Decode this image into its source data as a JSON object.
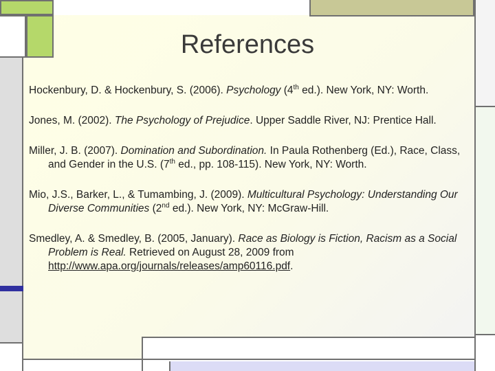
{
  "slide": {
    "title": "References"
  },
  "references": [
    {
      "authors": "Hockenbury, D. & Hockenbury, S. (2006).  ",
      "title": "Psychology",
      "t1": " (4",
      "sup": "th",
      "t2": " ed.).  New York, NY: Worth."
    },
    {
      "authors": "Jones, M. (2002).  ",
      "title": "The Psychology of Prejudice",
      "rest": ".  Upper Saddle River, NJ: Prentice Hall."
    },
    {
      "authors": "Miller, J. B. (2007).  ",
      "title": "Domination and Subordination.",
      "t1": "  In Paula Rothenberg (Ed.), Race, Class, and Gender in the U.S. (7",
      "sup": "th",
      "t2": " ed., pp. 108-115).  New York, NY: Worth."
    },
    {
      "authors": "Mio, J.S., Barker, L., & Tumambing, J.  (2009).  ",
      "title": "Multicultural Psychology: Understanding Our Diverse Communities",
      "t1": " (2",
      "sup": "nd",
      "t2": " ed.).  New York, NY: McGraw-Hill."
    },
    {
      "authors": "Smedley, A. & Smedley, B. (2005, January).  ",
      "title": "Race as Biology is Fiction, Racism as a Social Problem is Real.",
      "t1": "  Retrieved on August 28, 2009 from ",
      "link": "http://www.apa.org/journals/releases/amp60116.pdf",
      "t2": "."
    }
  ],
  "colors": {
    "accent_green": "#b5d86a",
    "accent_olive": "#c8c896",
    "accent_blue": "#3030a0",
    "accent_lavender": "#dcdcf6",
    "line_gray": "#707070"
  }
}
